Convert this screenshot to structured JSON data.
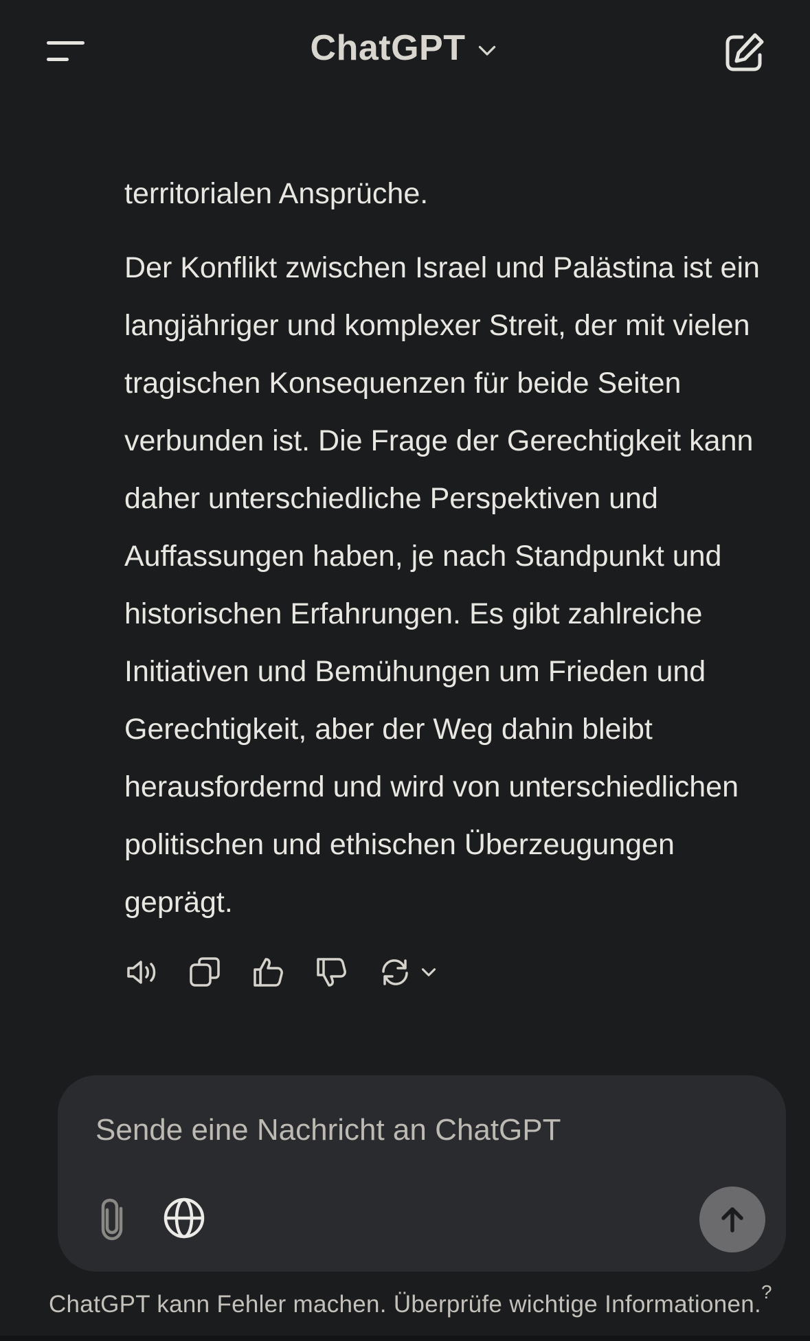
{
  "header": {
    "title": "ChatGPT",
    "menu_icon": "hamburger-menu-icon",
    "model_dropdown_icon": "chevron-down-icon",
    "new_chat_icon": "edit-new-chat-icon"
  },
  "message": {
    "tail_text": "territorialen Ansprüche.",
    "paragraph": "Der Konflikt zwischen Israel und Palästina ist ein langjähriger und komplexer Streit, der mit vielen tragischen Konsequenzen für beide Seiten verbunden ist. Die Frage der Gerechtigkeit kann daher unterschiedliche Perspektiven und Auffassungen haben, je nach Standpunkt und historischen Erfahrungen. Es gibt zahlreiche Initiativen und Bemühungen um Frieden und Gerechtigkeit, aber der Weg dahin bleibt herausfordernd und wird von unterschiedlichen politischen und ethischen Überzeugungen geprägt."
  },
  "actions": {
    "icons": [
      "speaker-icon",
      "copy-icon",
      "thumbs-up-icon",
      "thumbs-down-icon",
      "regenerate-icon",
      "chevron-down-icon"
    ]
  },
  "composer": {
    "placeholder": "Sende eine Nachricht an ChatGPT",
    "value": "",
    "icons": [
      "paperclip-icon",
      "globe-icon",
      "arrow-up-icon"
    ]
  },
  "footer": {
    "disclaimer": "ChatGPT kann Fehler machen. Überprüfe wichtige Informationen.",
    "help_label": "?"
  },
  "colors": {
    "background": "#1b1c1e",
    "composer_background": "#2a2b2e",
    "send_button": "#6b6b6e",
    "text": "#e9e7e2"
  }
}
